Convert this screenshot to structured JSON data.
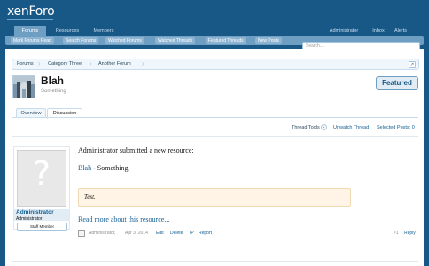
{
  "header": {
    "logo": "xenForo"
  },
  "nav": {
    "tabs": [
      {
        "label": "Forums",
        "active": true
      },
      {
        "label": "Resources"
      },
      {
        "label": "Members"
      }
    ],
    "right": [
      {
        "label": "Administrator"
      },
      {
        "label": "Inbox"
      },
      {
        "label": "Alerts"
      }
    ]
  },
  "subnav": {
    "links": [
      "Mark Forums Read",
      "Search Forums",
      "Watched Forums",
      "Watched Threads",
      "Featured Threads",
      "New Posts"
    ],
    "search_placeholder": "Search..."
  },
  "breadcrumb": [
    "Forums",
    "Category Three",
    "Another Forum"
  ],
  "thread": {
    "title": "Blah",
    "subtitle": "Something",
    "badge": "Featured"
  },
  "tabs": [
    "Overview",
    "Discussion"
  ],
  "thread_tools": {
    "tools": "Thread Tools",
    "unwatch": "Unwatch Thread",
    "selected": "Selected Posts: 0"
  },
  "post": {
    "user": {
      "name": "Administrator",
      "title": "Administrator",
      "badge": "Staff Member"
    },
    "heading": "Administrator submitted a new resource:",
    "resource_link": "Blah",
    "resource_sep": " - ",
    "resource_desc": "Something",
    "quote": "Test.",
    "read_more": "Read more about this resource...",
    "meta": {
      "author": "Administrator,",
      "date": "Apr 3, 2014",
      "edit": "Edit",
      "delete": "Delete",
      "ip": "IP",
      "report": "Report",
      "number": "#1",
      "reply": "Reply"
    }
  },
  "colors": {
    "header_bg": "#185886",
    "accent": "#176093",
    "quote_bg": "#fff4e5"
  }
}
